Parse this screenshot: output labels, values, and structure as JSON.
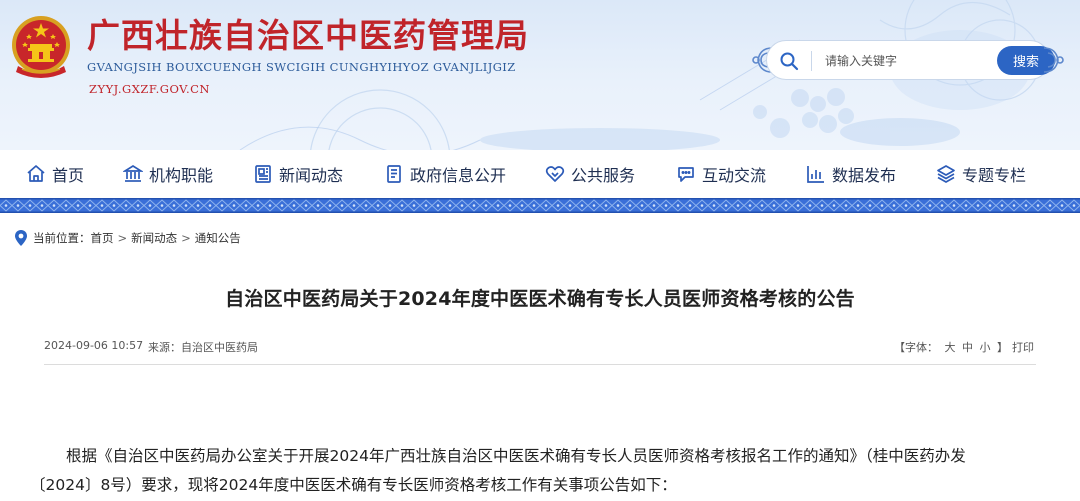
{
  "site": {
    "title": "广西壮族自治区中医药管理局",
    "subtitle": "GVANGJSIH BOUXCUENGH SWCIGIH CUNGHYIHYOZ GVANJLIJGIZ",
    "domain": "ZYYJ.GXZF.GOV.CN"
  },
  "search": {
    "placeholder": "请输入关键字",
    "button": "搜索"
  },
  "nav": {
    "items": [
      {
        "label": "首页",
        "icon": "home-icon"
      },
      {
        "label": "机构职能",
        "icon": "institution-icon"
      },
      {
        "label": "新闻动态",
        "icon": "news-icon"
      },
      {
        "label": "政府信息公开",
        "icon": "document-icon"
      },
      {
        "label": "公共服务",
        "icon": "heart-hand-icon"
      },
      {
        "label": "互动交流",
        "icon": "chat-icon"
      },
      {
        "label": "数据发布",
        "icon": "data-chart-icon"
      },
      {
        "label": "专题专栏",
        "icon": "layers-icon"
      }
    ]
  },
  "breadcrumb": {
    "prefix": "当前位置：",
    "items": [
      "首页",
      "新闻动态",
      "通知公告"
    ],
    "separator": ">"
  },
  "article": {
    "title": "自治区中医药局关于2024年度中医医术确有专长人员医师资格考核的公告",
    "date": "2024-09-06 10:57",
    "source": "来源：自治区中医药局",
    "font_label": "【字体：",
    "font_sizes": [
      "大",
      "中",
      "小"
    ],
    "font_close": "】",
    "print": "打印",
    "paragraph": "根据《自治区中医药局办公室关于开展2024年广西壮族自治区中医医术确有专长人员医师资格考核报名工作的通知》（桂中医药办发〔2024〕8号）要求，现将2024年度中医医术确有专长医师资格考核工作有关事项公告如下："
  },
  "colors": {
    "title_red": "#c0242a",
    "brand_blue": "#2c65c4",
    "nav_text": "#1f2f52",
    "band_blue": "#3a6fd8"
  }
}
